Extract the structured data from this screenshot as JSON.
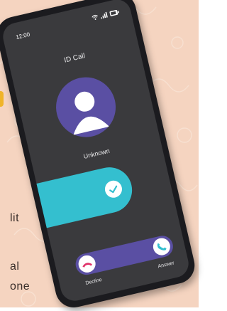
{
  "background": {
    "color": "#f5d4c0"
  },
  "side_text": {
    "line1": "lit",
    "line2": "al",
    "line3": "one"
  },
  "status_bar": {
    "time": "12:00"
  },
  "call": {
    "title": "ID Call",
    "caller_name": "Unknown",
    "decline_label": "Decline",
    "answer_label": "Answer"
  },
  "colors": {
    "avatar_bg": "#5a4fa3",
    "answer_panel": "#34bfcf",
    "pill": "#5a4fa3",
    "decline_icon": "#e0336a",
    "answer_icon": "#34bfcf",
    "phone_frame": "#1b1b1f",
    "screen": "#3a3a3d"
  },
  "icons": {
    "wifi": "wifi-icon",
    "signal": "signal-icon",
    "battery": "battery-icon",
    "avatar": "user-avatar-icon",
    "check": "check-icon",
    "decline": "phone-hangup-icon",
    "answer": "phone-icon"
  }
}
